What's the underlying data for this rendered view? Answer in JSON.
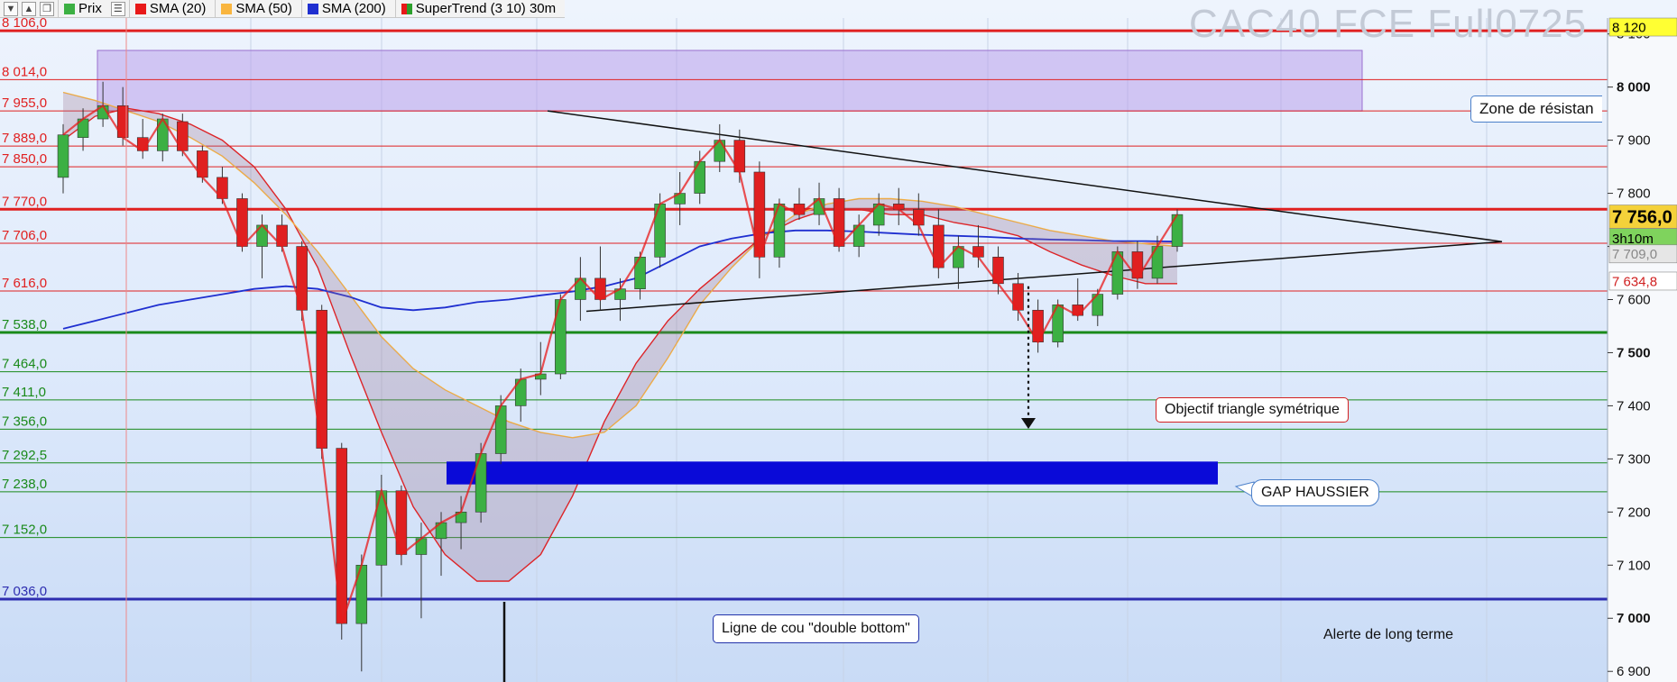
{
  "toolbar": {
    "icons": [
      "down-arrow-icon",
      "up-arrow-icon",
      "window-icon",
      "list-icon"
    ],
    "items": [
      {
        "label": "Prix",
        "color": "#3cb043"
      },
      {
        "label": "SMA (20)",
        "color": "#e81919"
      },
      {
        "label": "SMA (50)",
        "color": "#f9b53f"
      },
      {
        "label": "SMA (200)",
        "color": "#1f2fd0"
      },
      {
        "label": "SuperTrend (3 10) 30m",
        "color": "#2ca02c"
      }
    ]
  },
  "watermark": "CAC40 FCE Full0725",
  "annotations": {
    "zone_resistance": "Zone de résistan",
    "objectif": "Objectif triangle symétrique",
    "gap": "GAP HAUSSIER",
    "ligne_cou": "Ligne de cou \"double bottom\"",
    "alerte": "Alerte de long terme"
  },
  "right_labels": {
    "top_badge": "8 120",
    "price_badge": "7 756,0",
    "time_badge": "3h10m",
    "gray_badge": "7 709,0",
    "red_badge": "7 634,8"
  },
  "chart_data": {
    "type": "candlestick",
    "title": "CAC40 FCE Full0725",
    "ylim": [
      6880,
      8130
    ],
    "y_ticks": [
      6900,
      7000,
      7100,
      7200,
      7300,
      7400,
      7500,
      7600,
      7700,
      7800,
      7900,
      8000,
      8100
    ],
    "y_tick_labels": [
      "6 900",
      "7 000",
      "7 100",
      "7 200",
      "7 300",
      "7 400",
      "7 500",
      "7 600",
      "7 700",
      "7 800",
      "7 900",
      "8 000",
      "8 100"
    ],
    "horizontal_levels": [
      {
        "value": 8106.0,
        "label": "8 106,0",
        "color": "#e02020",
        "bold": true
      },
      {
        "value": 8014.0,
        "label": "8 014,0",
        "color": "#e02020"
      },
      {
        "value": 7955.0,
        "label": "7 955,0",
        "color": "#e02020"
      },
      {
        "value": 7889.0,
        "label": "7 889,0",
        "color": "#e02020"
      },
      {
        "value": 7850.0,
        "label": "7 850,0",
        "color": "#e02020"
      },
      {
        "value": 7770.0,
        "label": "7 770,0",
        "color": "#e02020",
        "bold": true
      },
      {
        "value": 7706.0,
        "label": "7 706,0",
        "color": "#e02020"
      },
      {
        "value": 7616.0,
        "label": "7 616,0",
        "color": "#e02020"
      },
      {
        "value": 7538.0,
        "label": "7 538,0",
        "color": "#1a8a1a",
        "bold": true
      },
      {
        "value": 7464.0,
        "label": "7 464,0",
        "color": "#1a8a1a"
      },
      {
        "value": 7411.0,
        "label": "7 411,0",
        "color": "#1a8a1a"
      },
      {
        "value": 7356.0,
        "label": "7 356,0",
        "color": "#1a8a1a"
      },
      {
        "value": 7292.5,
        "label": "7 292,5",
        "color": "#1a8a1a"
      },
      {
        "value": 7238.0,
        "label": "7 238,0",
        "color": "#1a8a1a"
      },
      {
        "value": 7152.0,
        "label": "7 152,0",
        "color": "#1a8a1a"
      },
      {
        "value": 7036.0,
        "label": "7 036,0",
        "color": "#2d2db0",
        "bold": true
      }
    ],
    "resistance_zone": [
      7955,
      8069
    ],
    "gap_zone": [
      7252,
      7295
    ],
    "current_price": 7756.0,
    "series": [
      {
        "name": "SMA (20)",
        "color": "#e81919",
        "values": [
          7900,
          7945,
          7960,
          7950,
          7930,
          7900,
          7850,
          7770,
          7660,
          7500,
          7350,
          7210,
          7120,
          7070,
          7070,
          7120,
          7230,
          7370,
          7480,
          7560,
          7620,
          7670,
          7720,
          7750,
          7770,
          7770,
          7760,
          7760,
          7745,
          7735,
          7720,
          7690,
          7665,
          7645,
          7630,
          7630
        ]
      },
      {
        "name": "SMA (50)",
        "color": "#f9b53f",
        "values": [
          7990,
          7975,
          7955,
          7935,
          7905,
          7870,
          7820,
          7760,
          7690,
          7610,
          7530,
          7470,
          7430,
          7400,
          7370,
          7350,
          7340,
          7350,
          7400,
          7490,
          7590,
          7660,
          7720,
          7760,
          7780,
          7790,
          7790,
          7785,
          7775,
          7760,
          7745,
          7730,
          7720,
          7710,
          7705,
          7700
        ]
      },
      {
        "name": "SMA (200)",
        "color": "#1f2fd0",
        "values": [
          7545,
          7560,
          7575,
          7590,
          7600,
          7610,
          7620,
          7625,
          7620,
          7605,
          7585,
          7580,
          7585,
          7595,
          7600,
          7608,
          7615,
          7625,
          7640,
          7670,
          7700,
          7715,
          7725,
          7730,
          7730,
          7728,
          7725,
          7722,
          7720,
          7718,
          7715,
          7713,
          7712,
          7710,
          7710,
          7709
        ]
      }
    ],
    "candles": [
      [
        7830,
        7930,
        7800,
        7910
      ],
      [
        7905,
        7960,
        7880,
        7940
      ],
      [
        7940,
        8010,
        7925,
        7965
      ],
      [
        7965,
        8000,
        7890,
        7905
      ],
      [
        7905,
        7940,
        7865,
        7880
      ],
      [
        7880,
        7950,
        7860,
        7940
      ],
      [
        7935,
        7950,
        7870,
        7880
      ],
      [
        7880,
        7890,
        7820,
        7830
      ],
      [
        7830,
        7850,
        7780,
        7790
      ],
      [
        7790,
        7800,
        7690,
        7700
      ],
      [
        7700,
        7760,
        7640,
        7740
      ],
      [
        7740,
        7760,
        7690,
        7700
      ],
      [
        7700,
        7710,
        7560,
        7580
      ],
      [
        7580,
        7590,
        7300,
        7320
      ],
      [
        7320,
        7330,
        6960,
        6990
      ],
      [
        6990,
        7120,
        6900,
        7100
      ],
      [
        7100,
        7270,
        7040,
        7240
      ],
      [
        7240,
        7250,
        7100,
        7120
      ],
      [
        7120,
        7180,
        7000,
        7150
      ],
      [
        7150,
        7200,
        7080,
        7180
      ],
      [
        7180,
        7230,
        7130,
        7200
      ],
      [
        7200,
        7330,
        7180,
        7310
      ],
      [
        7310,
        7420,
        7290,
        7400
      ],
      [
        7400,
        7470,
        7370,
        7450
      ],
      [
        7450,
        7520,
        7420,
        7460
      ],
      [
        7460,
        7610,
        7450,
        7600
      ],
      [
        7600,
        7680,
        7560,
        7640
      ],
      [
        7640,
        7700,
        7580,
        7600
      ],
      [
        7600,
        7640,
        7560,
        7620
      ],
      [
        7620,
        7690,
        7600,
        7680
      ],
      [
        7680,
        7800,
        7660,
        7780
      ],
      [
        7780,
        7840,
        7740,
        7800
      ],
      [
        7800,
        7880,
        7780,
        7860
      ],
      [
        7860,
        7930,
        7840,
        7900
      ],
      [
        7900,
        7920,
        7820,
        7840
      ],
      [
        7840,
        7860,
        7640,
        7680
      ],
      [
        7680,
        7790,
        7660,
        7780
      ],
      [
        7780,
        7810,
        7750,
        7760
      ],
      [
        7760,
        7820,
        7740,
        7790
      ],
      [
        7790,
        7810,
        7690,
        7700
      ],
      [
        7700,
        7760,
        7680,
        7740
      ],
      [
        7740,
        7800,
        7720,
        7780
      ],
      [
        7780,
        7810,
        7740,
        7770
      ],
      [
        7770,
        7800,
        7720,
        7740
      ],
      [
        7740,
        7770,
        7640,
        7660
      ],
      [
        7660,
        7720,
        7620,
        7700
      ],
      [
        7700,
        7740,
        7660,
        7680
      ],
      [
        7680,
        7700,
        7610,
        7630
      ],
      [
        7630,
        7650,
        7560,
        7580
      ],
      [
        7580,
        7600,
        7500,
        7520
      ],
      [
        7520,
        7600,
        7510,
        7590
      ],
      [
        7590,
        7640,
        7560,
        7570
      ],
      [
        7570,
        7620,
        7550,
        7610
      ],
      [
        7610,
        7700,
        7600,
        7690
      ],
      [
        7690,
        7710,
        7620,
        7640
      ],
      [
        7640,
        7720,
        7630,
        7700
      ],
      [
        7700,
        7770,
        7690,
        7760
      ]
    ],
    "triangle": {
      "upper_start": 7955,
      "upper_end": 7709,
      "lower_start": 7578,
      "lower_end": 7709
    },
    "target_arrow": {
      "from": 7625,
      "to": 7360
    }
  }
}
